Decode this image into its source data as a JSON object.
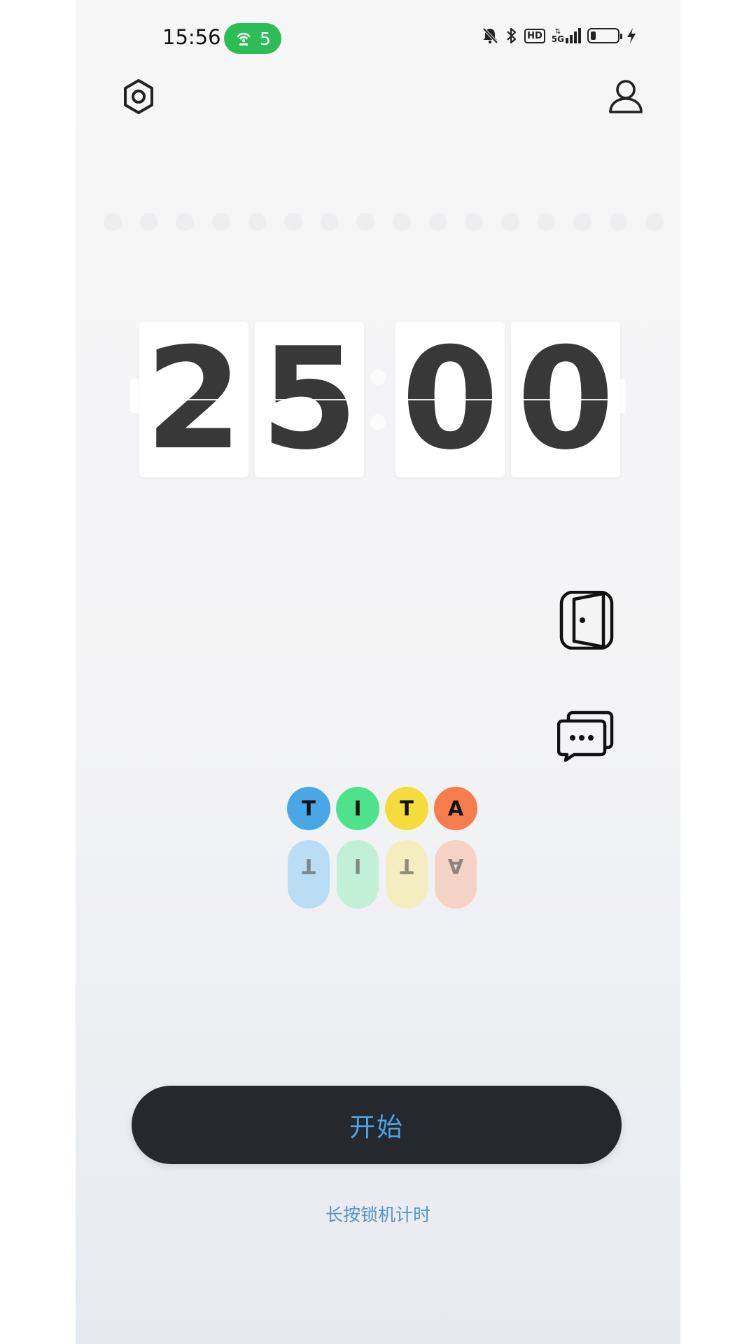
{
  "status_bar": {
    "time": "15:56",
    "hotspot_count": "5",
    "hd_label": "HD",
    "network_label": "5G",
    "icons": [
      "hotspot-icon",
      "silent-icon",
      "bluetooth-icon",
      "hd-icon",
      "5g-signal-icon",
      "battery-icon",
      "charging-icon"
    ]
  },
  "header": {
    "settings_icon": "settings-icon",
    "profile_icon": "profile-icon"
  },
  "timer": {
    "digits": [
      "2",
      "5",
      "0",
      "0"
    ]
  },
  "side_actions": {
    "exit_icon": "door-exit-icon",
    "chat_icon": "chat-bubbles-icon"
  },
  "badges": [
    {
      "letter": "T",
      "color": "#4aa7e6",
      "reflect_color": "#a9d5f4"
    },
    {
      "letter": "I",
      "color": "#4fe28c",
      "reflect_color": "#b3f0cd"
    },
    {
      "letter": "T",
      "color": "#f4dc3c",
      "reflect_color": "#f6ecae"
    },
    {
      "letter": "A",
      "color": "#f57c4c",
      "reflect_color": "#f6c8b6"
    }
  ],
  "start_button": {
    "label": "开始"
  },
  "hint": {
    "text": "长按锁机计时"
  },
  "colors": {
    "button_bg": "#25282c",
    "accent_blue": "#4aa3e8",
    "digit_color": "#383838",
    "hotspot_green": "#2dbd57"
  }
}
